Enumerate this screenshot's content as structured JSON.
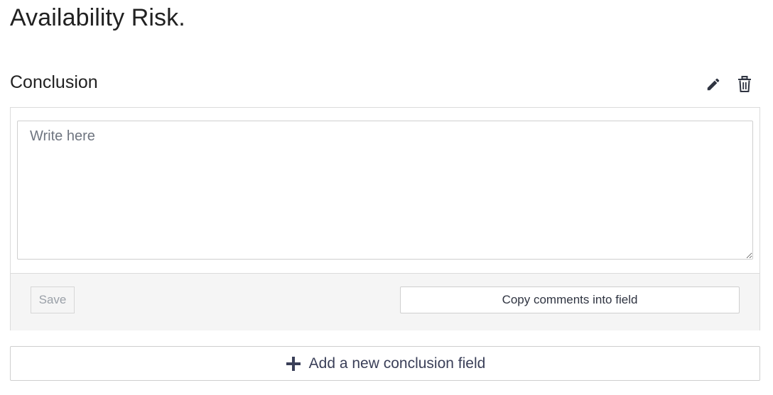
{
  "page": {
    "title": "Availability Risk."
  },
  "conclusion": {
    "title": "Conclusion",
    "edit_icon": "pencil-icon",
    "delete_icon": "trash-icon",
    "input_placeholder": "Write here",
    "input_value": "",
    "save_label": "Save",
    "copy_label": "Copy comments into field"
  },
  "add_field": {
    "icon": "plus-icon",
    "label": "Add a new conclusion field"
  },
  "colors": {
    "text": "#212121",
    "accent": "#3a3f58",
    "footer_bg": "#f5f5f5",
    "border": "#dcdcdc"
  }
}
